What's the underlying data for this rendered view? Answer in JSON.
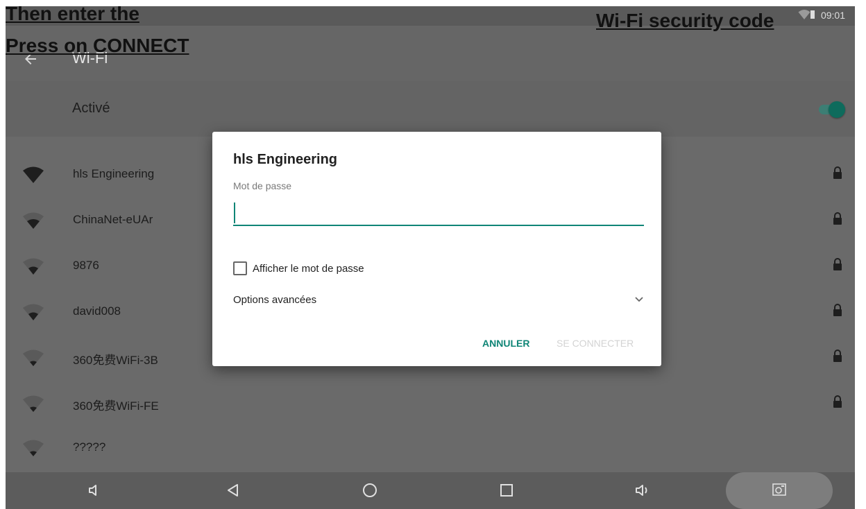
{
  "annotations": {
    "line1": "Then enter the",
    "line2": "Press on CONNECT",
    "line3": "Wi-Fi security code"
  },
  "status_bar": {
    "time": "09:01"
  },
  "app_bar": {
    "title": "Wi-Fi"
  },
  "wifi_toggle": {
    "label": "Activé",
    "state": "on"
  },
  "networks": [
    {
      "name": "hls Engineering",
      "secured": true
    },
    {
      "name": "ChinaNet-eUAr",
      "secured": true
    },
    {
      "name": "9876",
      "secured": true
    },
    {
      "name": "david008",
      "secured": true
    },
    {
      "name": "360免费WiFi-3B",
      "secured": true
    },
    {
      "name": "360免费WiFi-FE",
      "secured": true
    },
    {
      "name": "?????",
      "secured": false
    }
  ],
  "dialog": {
    "title": "hls Engineering",
    "password_label": "Mot de passe",
    "password_value": "",
    "show_password_label": "Afficher le mot de passe",
    "show_password_checked": false,
    "advanced_label": "Options avancées",
    "cancel_label": "ANNULER",
    "connect_label": "SE CONNECTER"
  },
  "colors": {
    "accent": "#0f8576",
    "dim_background": "#6a6a6a"
  },
  "icons": [
    "back-arrow-icon",
    "wifi-icon",
    "lock-icon",
    "chevron-down-icon",
    "volume-down-icon",
    "nav-back-icon",
    "nav-home-icon",
    "nav-recents-icon",
    "volume-up-icon",
    "screenshot-icon"
  ]
}
